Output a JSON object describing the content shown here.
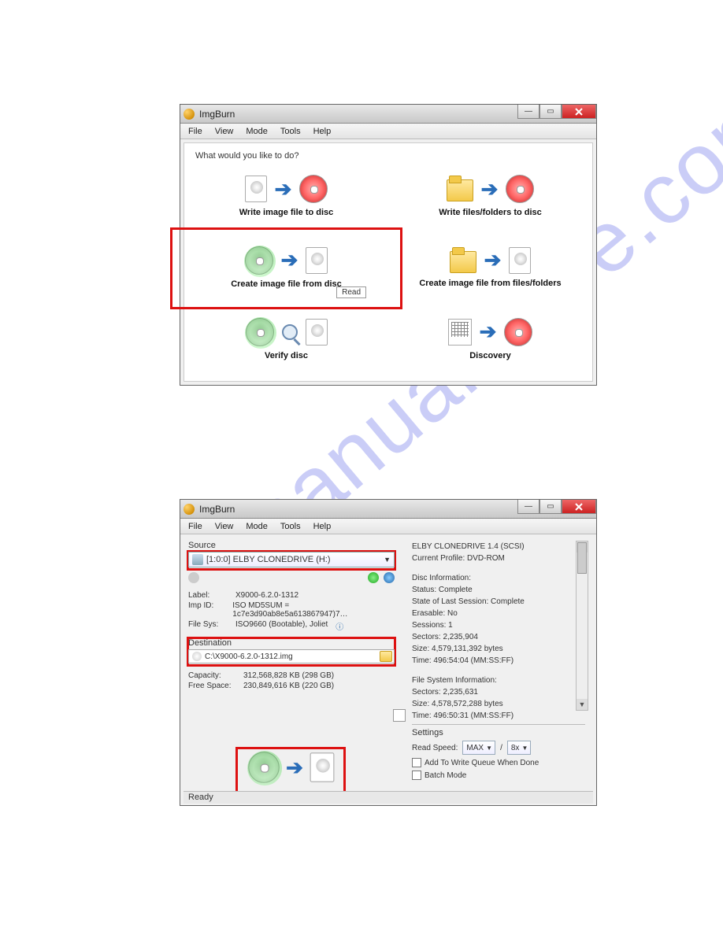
{
  "watermark": "manualshive.com",
  "app": {
    "title": "ImgBurn"
  },
  "menu": [
    "File",
    "View",
    "Mode",
    "Tools",
    "Help"
  ],
  "win1": {
    "prompt": "What would you like to do?",
    "modes": {
      "write_image": "Write image file to disc",
      "write_files": "Write files/folders to disc",
      "create_from_disc": "Create image file from disc",
      "create_from_files": "Create image file from files/folders",
      "verify": "Verify disc",
      "discovery": "Discovery"
    },
    "tooltip_read": "Read"
  },
  "win2": {
    "source_label": "Source",
    "source_drive": "[1:0:0] ELBY CLONEDRIVE (H:)",
    "label_k": "Label:",
    "label_v": "X9000-6.2.0-1312",
    "impid_k": "Imp ID:",
    "impid_v": "ISO MD5SUM = 1c7e3d90ab8e5a613867947)7…",
    "filesys_k": "File Sys:",
    "filesys_v": "ISO9660 (Bootable), Joliet",
    "dest_label": "Destination",
    "dest_path": "C:\\X9000-6.2.0-1312.img",
    "capacity_k": "Capacity:",
    "capacity_v": "312,568,828 KB  (298 GB)",
    "free_k": "Free Space:",
    "free_v": "230,849,616 KB  (220 GB)",
    "right": {
      "drive": "ELBY CLONEDRIVE 1.4 (SCSI)",
      "profile": "Current Profile: DVD-ROM",
      "disc_hdr": "Disc Information:",
      "status": "Status: Complete",
      "last_session": "State of Last Session: Complete",
      "erasable": "Erasable: No",
      "sessions": "Sessions: 1",
      "sectors": "Sectors: 2,235,904",
      "size": "Size: 4,579,131,392 bytes",
      "time": "Time: 496:54:04 (MM:SS:FF)",
      "fs_hdr": "File System Information:",
      "fs_sectors": "Sectors: 2,235,631",
      "fs_size": "Size: 4,578,572,288 bytes",
      "fs_time": "Time: 496:50:31 (MM:SS:FF)"
    },
    "settings_label": "Settings",
    "read_speed_label": "Read Speed:",
    "read_speed_val": "MAX",
    "slash": "/",
    "retries_val": "8x",
    "add_queue": "Add To Write Queue When Done",
    "batch": "Batch Mode",
    "status": "Ready"
  }
}
